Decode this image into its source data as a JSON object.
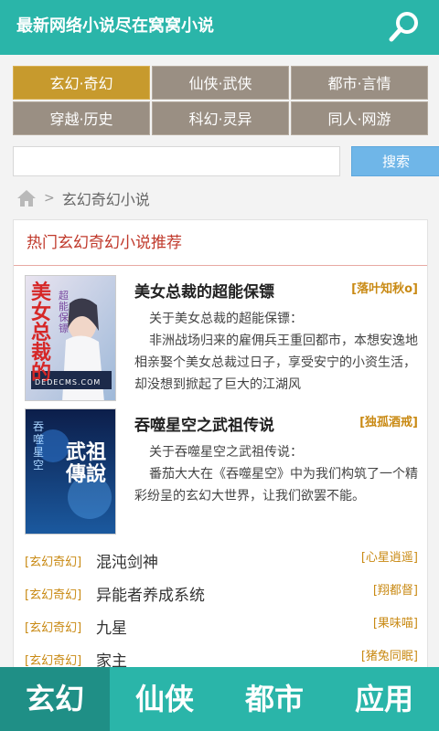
{
  "header": {
    "title": "最新网络小说尽在窝窝小说",
    "search_icon": "search-icon"
  },
  "categories": [
    {
      "label": "玄幻·奇幻",
      "active": true
    },
    {
      "label": "仙侠·武侠",
      "active": false
    },
    {
      "label": "都市·言情",
      "active": false
    },
    {
      "label": "穿越·历史",
      "active": false
    },
    {
      "label": "科幻·灵异",
      "active": false
    },
    {
      "label": "同人·网游",
      "active": false
    }
  ],
  "search": {
    "value": "",
    "placeholder": "",
    "button_label": "搜索"
  },
  "breadcrumb": {
    "home_icon": "home-icon",
    "separator": ">",
    "current": "玄幻奇幻小说"
  },
  "section": {
    "title": "热门玄幻奇幻小说推荐"
  },
  "featured": [
    {
      "title": "美女总裁的超能保镖",
      "author": "[落叶知秋o]",
      "lead": "关于美女总裁的超能保镖：",
      "desc": "非洲战场归来的雇佣兵王重回都市，本想安逸地相亲娶个美女总裁过日子，享受安宁的小资生活，却没想到掀起了巨大的江湖风",
      "cover_text": "美女总裁的",
      "cover_sub": "超能保镖",
      "cover_site": "DEDECMS.COM"
    },
    {
      "title": "吞噬星空之武祖传说",
      "author": "[独孤酒戒]",
      "lead": "关于吞噬星空之武祖传说：",
      "desc": "番茄大大在《吞噬星空》中为我们构筑了一个精彩纷呈的玄幻大世界，让我们欲罢不能。",
      "cover_text": "武祖傳說",
      "cover_sub": "吞噬星空"
    }
  ],
  "list": [
    {
      "tag": "[玄幻奇幻]",
      "name": "混沌剑神",
      "author": "[心星逍遥]"
    },
    {
      "tag": "[玄幻奇幻]",
      "name": "异能者养成系统",
      "author": "[翔都督]"
    },
    {
      "tag": "[玄幻奇幻]",
      "name": "九星",
      "author": "[果味喵]"
    },
    {
      "tag": "[玄幻奇幻]",
      "name": "家主",
      "author": "[猪兔同眠]"
    }
  ],
  "tabs": [
    {
      "label": "玄幻",
      "active": true
    },
    {
      "label": "仙侠",
      "active": false
    },
    {
      "label": "都市",
      "active": false
    },
    {
      "label": "应用",
      "active": false
    }
  ],
  "colors": {
    "header": "#2ab5a9",
    "active_tab": "#1f8f86",
    "category_active": "#c79a2d",
    "category": "#9a8f83",
    "author": "#c98a14",
    "section_title": "#c0392b"
  }
}
